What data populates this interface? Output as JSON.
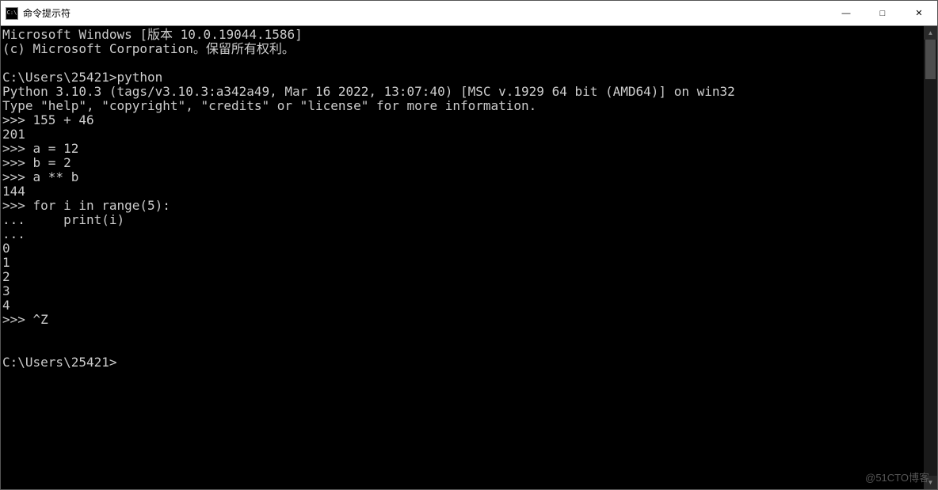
{
  "titlebar": {
    "icon_label": "C:\\",
    "title": "命令提示符",
    "minimize": "—",
    "maximize": "□",
    "close": "✕"
  },
  "terminal": {
    "lines": [
      "Microsoft Windows [版本 10.0.19044.1586]",
      "(c) Microsoft Corporation。保留所有权利。",
      "",
      "C:\\Users\\25421>python",
      "Python 3.10.3 (tags/v3.10.3:a342a49, Mar 16 2022, 13:07:40) [MSC v.1929 64 bit (AMD64)] on win32",
      "Type \"help\", \"copyright\", \"credits\" or \"license\" for more information.",
      ">>> 155 + 46",
      "201",
      ">>> a = 12",
      ">>> b = 2",
      ">>> a ** b",
      "144",
      ">>> for i in range(5):",
      "...     print(i)",
      "...",
      "0",
      "1",
      "2",
      "3",
      "4",
      ">>> ^Z",
      "",
      "",
      "C:\\Users\\25421>"
    ]
  },
  "scrollbar": {
    "up": "▲",
    "down": "▼"
  },
  "watermark": "@51CTO博客"
}
